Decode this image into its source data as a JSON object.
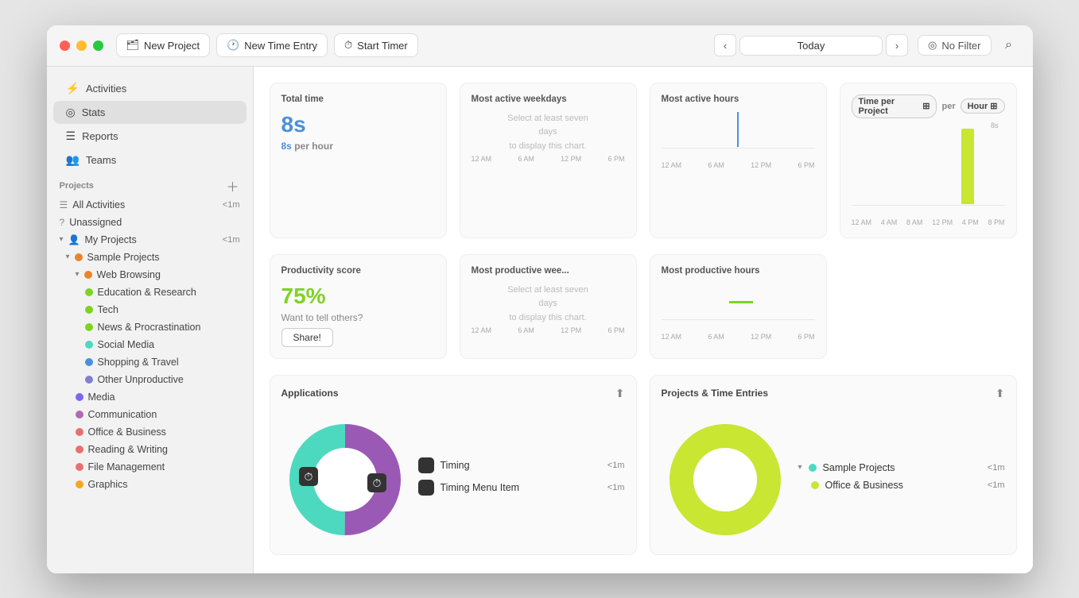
{
  "window": {
    "titlebar": {
      "new_project_label": "New Project",
      "new_time_entry_label": "New Time Entry",
      "start_timer_label": "Start Timer",
      "date_label": "Today",
      "no_filter_label": "No Filter"
    }
  },
  "sidebar": {
    "nav_items": [
      {
        "id": "activities",
        "label": "Activities",
        "icon": "⚡"
      },
      {
        "id": "stats",
        "label": "Stats",
        "icon": "◎",
        "active": true
      },
      {
        "id": "reports",
        "label": "Reports",
        "icon": "☰"
      },
      {
        "id": "teams",
        "label": "Teams",
        "icon": "👥"
      }
    ],
    "projects_header": "Projects",
    "projects": [
      {
        "id": "all",
        "label": "All Activities",
        "badge": "<1m",
        "indent": 0,
        "color": "#888",
        "icon": "☰"
      },
      {
        "id": "unassigned",
        "label": "Unassigned",
        "badge": "",
        "indent": 0,
        "color": "#888",
        "icon": "?"
      },
      {
        "id": "my-projects",
        "label": "My Projects",
        "badge": "<1m",
        "indent": 0,
        "color": "#888",
        "icon": "👤",
        "chevron": "▾"
      },
      {
        "id": "sample-projects",
        "label": "Sample Projects",
        "badge": "",
        "indent": 1,
        "color": "#e8852a",
        "dot": true,
        "chevron": "▾"
      },
      {
        "id": "web-browsing",
        "label": "Web Browsing",
        "badge": "",
        "indent": 2,
        "color": "#e8852a",
        "dot": true,
        "chevron": "▾"
      },
      {
        "id": "education",
        "label": "Education & Research",
        "badge": "",
        "indent": 3,
        "color": "#7ed321",
        "dot": true
      },
      {
        "id": "tech",
        "label": "Tech",
        "badge": "",
        "indent": 3,
        "color": "#7ed321",
        "dot": true
      },
      {
        "id": "news",
        "label": "News & Procrastination",
        "badge": "",
        "indent": 3,
        "color": "#7ed321",
        "dot": true
      },
      {
        "id": "social",
        "label": "Social Media",
        "badge": "",
        "indent": 3,
        "color": "#4dd9c0",
        "dot": true
      },
      {
        "id": "shopping",
        "label": "Shopping & Travel",
        "badge": "",
        "indent": 3,
        "color": "#4a90d9",
        "dot": true
      },
      {
        "id": "other",
        "label": "Other Unproductive",
        "badge": "",
        "indent": 3,
        "color": "#8080d0",
        "dot": true
      },
      {
        "id": "media",
        "label": "Media",
        "badge": "",
        "indent": 2,
        "color": "#7b68ee",
        "dot": true
      },
      {
        "id": "communication",
        "label": "Communication",
        "badge": "",
        "indent": 2,
        "color": "#b06ab3",
        "dot": true
      },
      {
        "id": "office",
        "label": "Office & Business",
        "badge": "",
        "indent": 2,
        "color": "#e87070",
        "dot": true
      },
      {
        "id": "reading",
        "label": "Reading & Writing",
        "badge": "",
        "indent": 2,
        "color": "#e87070",
        "dot": true
      },
      {
        "id": "file",
        "label": "File Management",
        "badge": "",
        "indent": 2,
        "color": "#e87070",
        "dot": true
      },
      {
        "id": "graphics",
        "label": "Graphics",
        "badge": "",
        "indent": 2,
        "color": "#f5a623",
        "dot": true
      }
    ]
  },
  "stats": {
    "total_time": {
      "title": "Total time",
      "value": "8s",
      "sub_label": "per hour",
      "sub_value": "8s"
    },
    "most_active_weekdays": {
      "title": "Most active weekdays",
      "placeholder": "Select at least seven\ndays\nto display this chart.",
      "labels": [
        "12 AM",
        "6 AM",
        "12 PM",
        "6 PM"
      ]
    },
    "most_active_hours": {
      "title": "Most active hours",
      "labels": [
        "12 AM",
        "6 AM",
        "12 PM",
        "6 PM"
      ]
    },
    "time_per_project": {
      "title": "Time per Project",
      "per_label": "per",
      "hour_label": "Hour",
      "bar_value_label": "8s",
      "labels": [
        "12 AM",
        "4 AM",
        "8 AM",
        "12 PM",
        "4 PM",
        "8 PM"
      ]
    },
    "productivity": {
      "title": "Productivity score",
      "value": "75%",
      "sub_label": "Want to tell others?",
      "share_label": "Share!"
    },
    "most_productive_week": {
      "title": "Most productive wee...",
      "placeholder": "Select at least seven\ndays\nto display this chart.",
      "labels": [
        "12 AM",
        "6 AM",
        "12 PM",
        "6 PM"
      ]
    },
    "most_productive_hours": {
      "title": "Most productive hours",
      "labels": [
        "12 AM",
        "6 AM",
        "12 PM",
        "6 PM"
      ]
    },
    "applications": {
      "title": "Applications",
      "items": [
        {
          "name": "Timing",
          "time": "<1m"
        },
        {
          "name": "Timing Menu Item",
          "time": "<1m"
        }
      ]
    },
    "projects_time_entries": {
      "title": "Projects & Time Entries",
      "items": [
        {
          "name": "Sample Projects",
          "time": "<1m",
          "color": "#4dd9c0",
          "chevron": true
        },
        {
          "name": "Office & Business",
          "time": "<1m",
          "color": "#c8e632",
          "indent": true
        }
      ]
    }
  }
}
